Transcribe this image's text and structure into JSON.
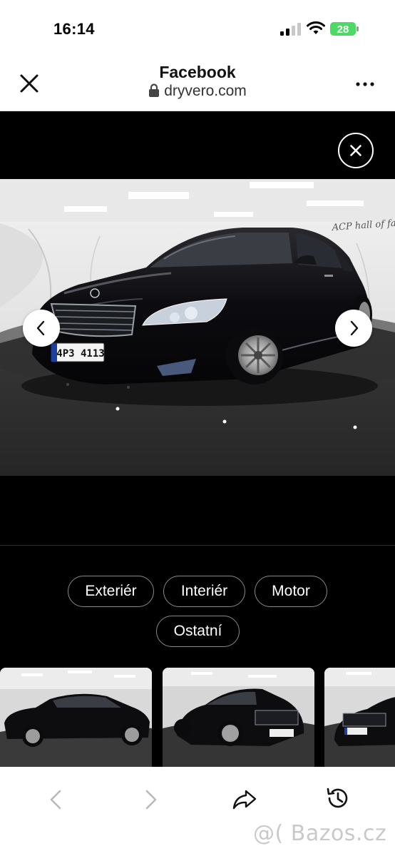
{
  "status_bar": {
    "time": "16:14",
    "battery": "28"
  },
  "header": {
    "title": "Facebook",
    "url": "dryvero.com"
  },
  "gallery": {
    "photo_watermark": "ACP hall of fame",
    "plate": "4P3 4113",
    "chips": [
      "Exteriér",
      "Interiér",
      "Motor",
      "Ostatní"
    ]
  },
  "watermark": "@( Bazos.cz",
  "icons": {
    "close": "close-icon",
    "more": "more-dots-icon",
    "lock": "lock-icon",
    "gallery_close": "close-circle-icon",
    "prev": "chevron-left-icon",
    "next": "chevron-right-icon",
    "back": "back-icon",
    "forward": "forward-icon",
    "share": "share-icon",
    "history": "history-icon"
  },
  "colors": {
    "gallery_bg": "#000000",
    "chip_border": "#8a8a8a",
    "battery_green": "#4cd964"
  }
}
